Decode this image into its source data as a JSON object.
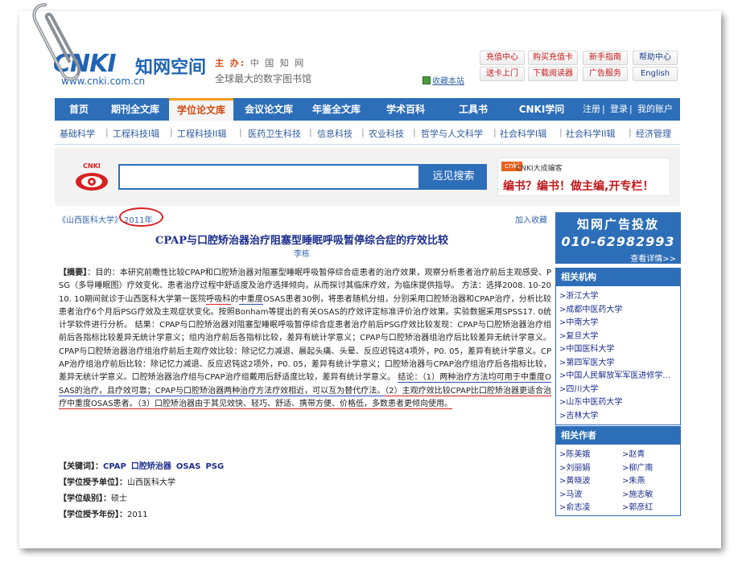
{
  "header": {
    "logo_text": "CNKI",
    "logo_cn": "知网空间",
    "logo_url": "www.cnki.com.cn",
    "sponsor_label": "主 办:",
    "sponsor_name": "中 国 知 网",
    "slogan": "全球最大的数字图书馆",
    "favorite": "收藏本站",
    "top_buttons": [
      "充值中心",
      "购买充值卡",
      "新手指南",
      "帮助中心",
      "送卡上门",
      "下载阅读器",
      "广告服务",
      "English"
    ]
  },
  "nav": {
    "items": [
      "首页",
      "期刊全文库",
      "学位论文库",
      "会议论文库",
      "年鉴全文库",
      "学术百科",
      "工具书",
      "CNKI学问"
    ],
    "active_index": 2,
    "login": "注册",
    "sep": "|",
    "register": "登录",
    "account": "我的账户"
  },
  "subnav": [
    "基础科学",
    "工程科技I辑",
    "工程科技II辑",
    "医药卫生科技",
    "信息科技",
    "农业科技",
    "哲学与人文科学",
    "社会科学I辑",
    "社会科学II辑",
    "经济管理"
  ],
  "search": {
    "logo_text": "CNKI",
    "value": "",
    "button": "远见搜索",
    "ad_tag": "cnki",
    "ad_tag_label": "CNKI大成编客",
    "ad_text": "编书？编书！做主编,开专栏！"
  },
  "article": {
    "crumb_school": "《山西医科大学》",
    "crumb_year": "2011年",
    "collect": "加入收藏",
    "title": "CPAP与口腔矫治器治疗阻塞型睡眠呼吸暂停综合症的疗效比较",
    "author": "李栋",
    "abstract_label": "【摘要】",
    "abstract_part1": "：目的：本研究前瞻性比较CPAP和口腔矫治器对阻塞型睡眠呼吸暂停综合症患者的治疗效果，观察分析患者治疗前后主观感受、PSG（多导睡眠图）疗效变化、患者治疗过程中舒适度及治疗选择倾向，从而探讨其临床疗效，为临床提供指导。 方法：选择2008. 10-2010. 10期间就诊于山西医科大学第一医院",
    "abstract_hl1": "呼吸科",
    "abstract_part2": "的",
    "abstract_hl2": "中重度",
    "abstract_part3": "OSAS患者30例，将患者随机分组，分别采用口腔矫治器和CPAP治疗，分析比较患者治疗6个月后PSG疗效及主观症状变化。按照Bonham等提出的有关OSAS的疗效评定标准评价治疗效果。实验数据采用SPSS17. 0统计学软件进行分析。 结果：CPAP与口腔矫治器对阻塞型睡眠呼吸暂停综合症患者治疗前后PSG疗效比较发现：CPAP与口腔矫治器治疗组前后各指标比较差异无统计学意义；组内治疗前后各指标比较，差异有统计学意义；CPAP与口腔矫治器组治疗后比较差异无统计学意义。CPAP与口腔矫治器治疗组治疗前后主观疗效比较：除记忆力减退、晨起头痛、头晕、反应迟钝这4项外，P0. 05，差异有统计学意义。CPAP治疗组治疗前后比较：除记忆力减退、反应迟钝这2项外，P0. 05，差异有统计学意义；口腔矫治器与CPAP治疗组治疗后各指标比较，差异无统计学意义。口腔矫治器治疗组与CPAP治疗组戴用后舒适度比较，差异有统计学意义。 ",
    "abstract_concl_1": "结论：（1）两种治疗方法均可用于中重度OSAS的治疗，且疗效可靠；CPAP与口腔矫治器两种治疗方法疗效相近，可以互为替代疗法。",
    "abstract_concl_2": "（2）主观疗效比较CPAP比口腔矫治器更适合治疗中重度OSAS患者。（3）口腔矫治器由于其见效快、轻巧、舒适、携带方便、价格低，多数患者更倾向使用。",
    "keywords_label": "【关键词】：",
    "keywords": [
      "CPAP",
      "口腔矫治器",
      "OSAS",
      "PSG"
    ],
    "unit_label": "【学位授予单位】：",
    "unit": "山西医科大学",
    "level_label": "【学位级别】：",
    "level": "硕士",
    "year_label": "【学位授予年份】：",
    "year": "2011"
  },
  "sidebar": {
    "ad_line1": "知网广告投放",
    "ad_line2": "010-62982993",
    "ad_line3": "查看详情>>",
    "orgs_title": "相关机构",
    "orgs": [
      ">浙江大学",
      ">成都中医药大学",
      ">中南大学",
      ">复旦大学",
      ">中国医科大学",
      ">第四军医大学",
      ">中国人民解放军军医进修学...",
      ">四川大学",
      ">山东中医药大学",
      ">吉林大学"
    ],
    "authors_title": "相关作者",
    "authors": [
      ">陈美娥",
      ">赵青",
      ">刘丽娟",
      ">柳广南",
      ">黄晓波",
      ">朱燕",
      ">马波",
      ">施志敏",
      ">俞志凌",
      ">郭彦红"
    ]
  }
}
